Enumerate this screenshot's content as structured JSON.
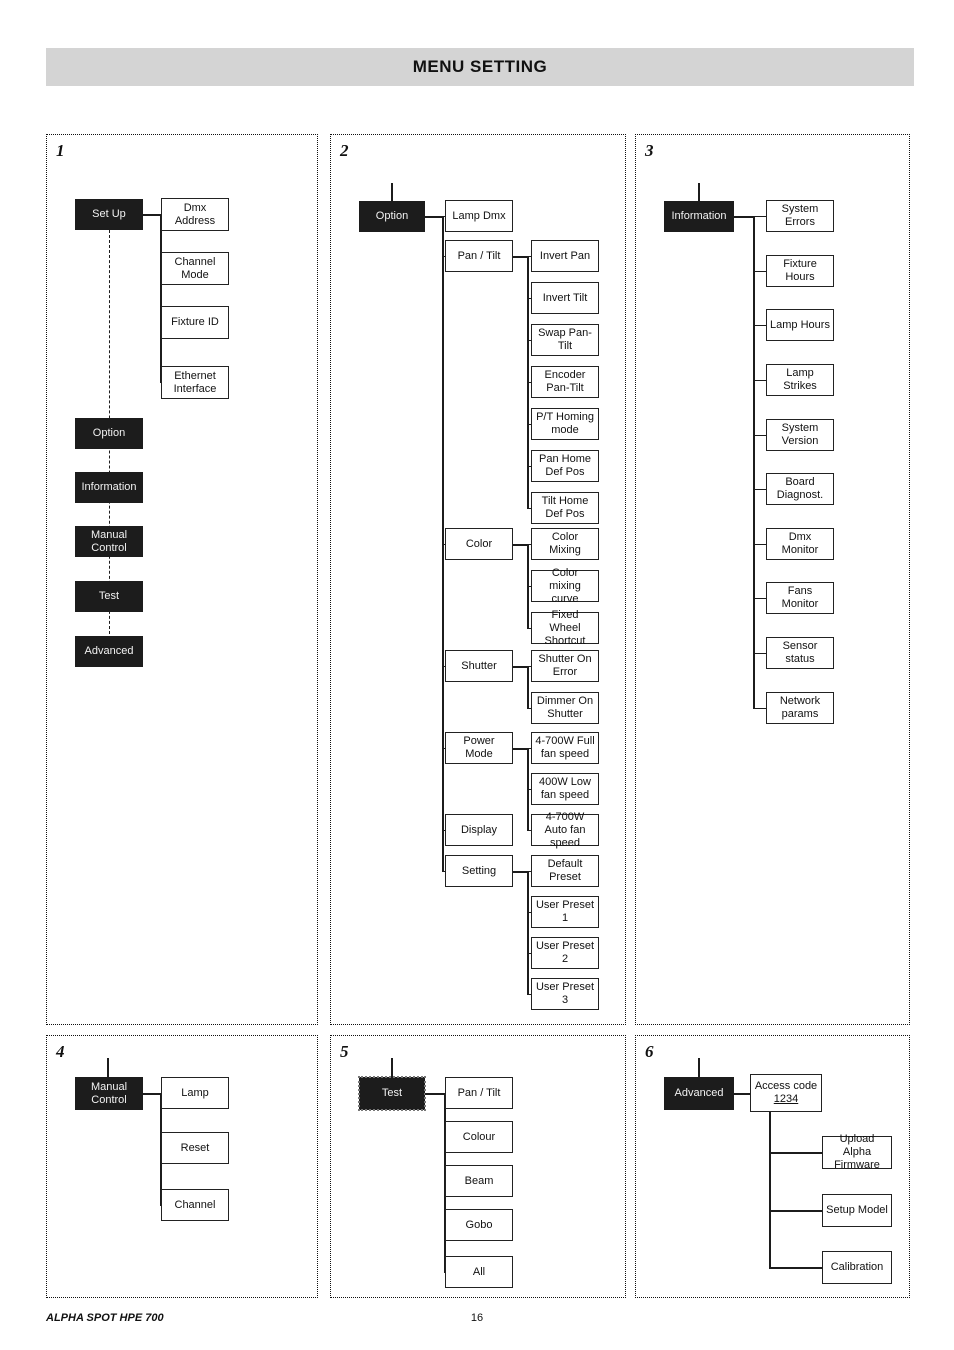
{
  "header": {
    "title": "MENU SETTING"
  },
  "footer": {
    "model": "ALPHA SPOT HPE 700",
    "page": "16"
  },
  "panels": [
    {
      "number": "1",
      "root": "Set Up",
      "children": [
        "Dmx Address",
        "Channel Mode",
        "Fixture ID",
        "Ethernet Interface"
      ],
      "siblings": [
        "Option",
        "Information",
        "Manual Control",
        "Test",
        "Advanced"
      ]
    },
    {
      "number": "2",
      "root": "Option",
      "children": [
        "Lamp Dmx",
        "Pan / Tilt",
        "Color",
        "Shutter",
        "Power Mode",
        "Display",
        "Setting"
      ],
      "grandchildren": [
        "Invert Pan",
        "Invert Tilt",
        "Swap Pan-Tilt",
        "Encoder Pan-Tilt",
        "P/T Homing mode",
        "Pan Home Def Pos",
        "Tilt Home Def Pos",
        "Color Mixing",
        "Color mixing curve",
        "Fixed Wheel Shortcut",
        "Shutter On Error",
        "Dimmer On Shutter",
        "4-700W Full fan speed",
        "400W Low fan speed",
        "4-700W Auto fan speed",
        "Default Preset",
        "User Preset 1",
        "User Preset 2",
        "User Preset 3"
      ]
    },
    {
      "number": "3",
      "root": "Information",
      "children": [
        "System Errors",
        "Fixture Hours",
        "Lamp Hours",
        "Lamp Strikes",
        "System Version",
        "Board Diagnost.",
        "Dmx Monitor",
        "Fans Monitor",
        "Sensor status",
        "Network params"
      ]
    },
    {
      "number": "4",
      "root": "Manual Control",
      "children": [
        "Lamp",
        "Reset",
        "Channel"
      ]
    },
    {
      "number": "5",
      "root": "Test",
      "children": [
        "Pan / Tilt",
        "Colour",
        "Beam",
        "Gobo",
        "All"
      ]
    },
    {
      "number": "6",
      "root": "Advanced",
      "children": [
        "Access code",
        "Upload Alpha Firmware",
        "Setup Model",
        "Calibration"
      ],
      "access_code_value": "1234"
    }
  ],
  "colors": {
    "header_band": "#d4d4d4",
    "node_black": "#1c1c1c",
    "node_text_light": "#f2f2f2",
    "line": "#1c1c1c",
    "page_background": "#ffffff"
  }
}
